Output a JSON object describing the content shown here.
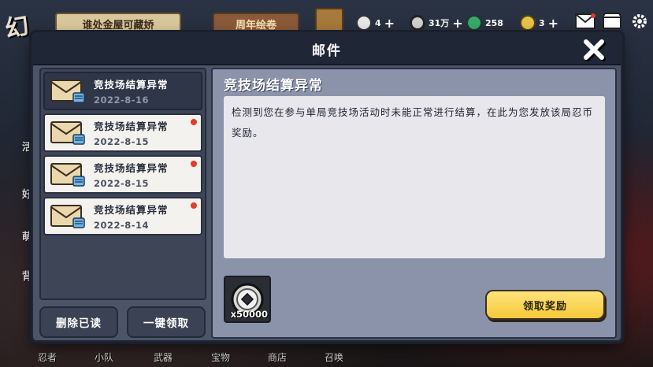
{
  "background": {
    "logo_text": "幻",
    "banner1": "谁处金屋可藏娇",
    "banner2": "周年绘卷",
    "currencies": [
      {
        "icon": "onigiri-icon",
        "value": "4",
        "color": "#e8e8e8"
      },
      {
        "icon": "coin-icon",
        "value": "31万",
        "color": "#cfcfcf"
      },
      {
        "icon": "jade-icon",
        "value": "258",
        "color": "#38a86a"
      },
      {
        "icon": "scroll-icon",
        "value": "3",
        "color": "#e6c34a"
      }
    ],
    "side_labels": [
      "活",
      "好",
      "萌",
      "背"
    ],
    "bottom_nav": [
      "忍者",
      "小队",
      "武器",
      "宝物",
      "商店",
      "召唤"
    ]
  },
  "dialog": {
    "title": "邮件",
    "close_icon": "close-icon"
  },
  "mails": [
    {
      "subject": "竞技场结算异常",
      "date": "2022-8-16",
      "selected": true,
      "unread": false
    },
    {
      "subject": "竞技场结算异常",
      "date": "2022-8-15",
      "selected": false,
      "unread": true
    },
    {
      "subject": "竞技场结算异常",
      "date": "2022-8-15",
      "selected": false,
      "unread": true
    },
    {
      "subject": "竞技场结算异常",
      "date": "2022-8-14",
      "selected": false,
      "unread": true
    }
  ],
  "list_buttons": {
    "delete_read": "删除已读",
    "claim_all": "一键领取"
  },
  "detail": {
    "title": "竞技场结算异常",
    "body": "检测到您在参与单局竞技场活动时未能正常进行结算，在此为您发放该局忍币奖励。",
    "reward": {
      "icon": "ninja-coin-icon",
      "quantity": "x50000"
    },
    "claim_button": "领取奖励"
  },
  "colors": {
    "accent_yellow": "#f5c83a",
    "unread_dot": "#e63b2a",
    "panel": "#4c5468",
    "header": "#1f2636"
  }
}
